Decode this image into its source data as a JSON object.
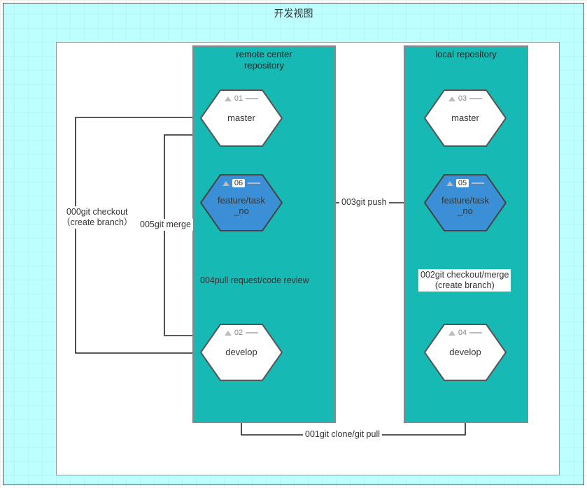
{
  "title": "开发视图",
  "containers": {
    "remote": {
      "title": "remote center\nrepository"
    },
    "local": {
      "title": "local repository"
    }
  },
  "nodes": {
    "remote_master": {
      "num": "01",
      "label": "master"
    },
    "remote_develop": {
      "num": "02",
      "label": "develop"
    },
    "remote_feature": {
      "num": "06",
      "label": "feature/task\n_no"
    },
    "local_master": {
      "num": "03",
      "label": "master"
    },
    "local_develop": {
      "num": "04",
      "label": "develop"
    },
    "local_feature": {
      "num": "05",
      "label": "feature/task\n_no"
    }
  },
  "edges": {
    "e000": "000git checkout\n（create branch）",
    "e001": "001git clone/git pull",
    "e002": "002git checkout/merge\n(create branch)",
    "e003": "003git push",
    "e004": "004pull request/code review",
    "e005": "005git merge"
  }
}
